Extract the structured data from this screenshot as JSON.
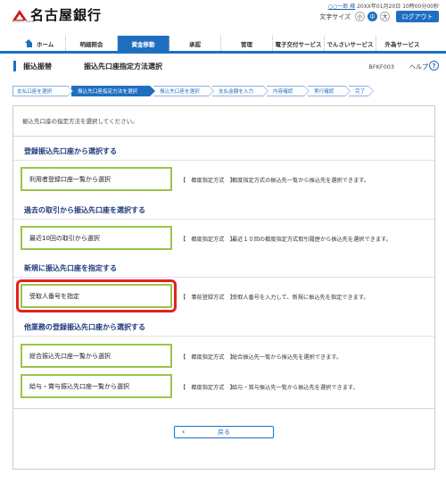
{
  "header": {
    "logo_text": "名古屋銀行",
    "logo_sub": "NAGOYA BANK",
    "user_name": "○○一郎 様",
    "login_time": "20XX年01月20日 10時00分00秒",
    "font_size_label": "文字サイズ",
    "font_small": "小",
    "font_medium": "中",
    "font_large": "大",
    "logout_label": "ログアウト"
  },
  "nav": {
    "items": [
      {
        "label": "ホーム"
      },
      {
        "label": "明細照会"
      },
      {
        "label": "資金移動"
      },
      {
        "label": "承認"
      },
      {
        "label": "管理"
      },
      {
        "label": "電子交付サービス"
      },
      {
        "label": "でんさいサービス"
      },
      {
        "label": "外為サービス"
      }
    ]
  },
  "page": {
    "category": "振込振替",
    "title": "振込先口座指定方法選択",
    "code": "BFKF003",
    "help_label": "ヘルプ",
    "help_icon": "?"
  },
  "steps": [
    {
      "label": "支払口座を選択"
    },
    {
      "label": "振込先口座指定方法を選択"
    },
    {
      "label": "振込先口座を選択"
    },
    {
      "label": "支払金額を入力"
    },
    {
      "label": "内容確認"
    },
    {
      "label": "実行確認"
    },
    {
      "label": "完了"
    }
  ],
  "content": {
    "instruction": "振込先口座の指定方法を選択してください。",
    "sections": [
      {
        "title": "登録振込先口座から選択する",
        "options": [
          {
            "label": "利用者登録口座一覧から選択",
            "tag": "【　都度指定方式　】",
            "desc": "都度指定方式の振込先一覧から振込先を選択できます。"
          }
        ]
      },
      {
        "title": "過去の取引から振込先口座を選択する",
        "options": [
          {
            "label": "最近10回の取引から選択",
            "tag": "【　都度指定方式　】",
            "desc": "最近１０回の都度指定方式取引履歴から振込先を選択できます。"
          }
        ]
      },
      {
        "title": "新規に振込先口座を指定する",
        "options": [
          {
            "label": "受取人番号を指定",
            "tag": "【　事前登録方式　】",
            "desc": "受取人番号を入力して、新規に振込先を指定できます。"
          }
        ]
      },
      {
        "title": "他業務の登録振込先口座から選択する",
        "options": [
          {
            "label": "総合振込先口座一覧から選択",
            "tag": "【　都度指定方式　】",
            "desc": "総合振込先一覧から振込先を選択できます。"
          },
          {
            "label": "給与・賞与振込先口座一覧から選択",
            "tag": "【　都度指定方式　】",
            "desc": "給与・賞与振込先一覧から振込先を選択できます。"
          }
        ]
      }
    ],
    "back_label": "戻る"
  },
  "colors": {
    "accent": "#1f6fc0",
    "option_border": "#9cc44a",
    "highlight": "#e32222",
    "section_title": "#1f3a7a"
  }
}
